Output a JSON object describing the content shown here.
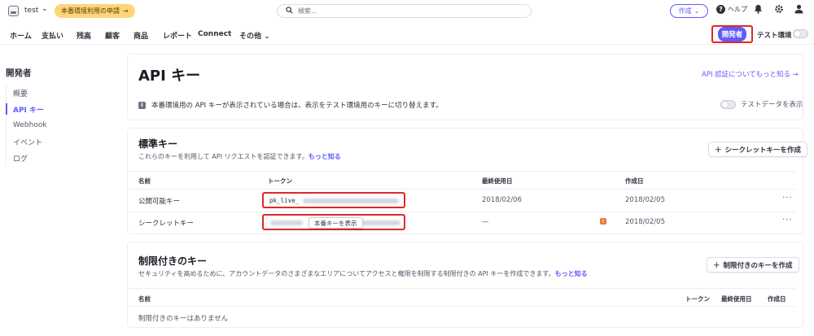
{
  "topbar": {
    "account_name": "test",
    "activate_label": "本番環境利用の申請",
    "search_placeholder": "検索...",
    "create_label": "作成",
    "help_label": "ヘルプ"
  },
  "nav": {
    "items": [
      "ホーム",
      "支払い",
      "残高",
      "顧客",
      "商品",
      "レポート",
      "Connect",
      "その他"
    ],
    "developer_label": "開発者",
    "test_mode_label": "テスト環境"
  },
  "sidebar": {
    "title": "開発者",
    "items": [
      {
        "label": "概要",
        "active": false
      },
      {
        "label": "API キー",
        "active": true
      },
      {
        "label": "Webhook",
        "active": false
      },
      {
        "label": "イベント",
        "active": false
      },
      {
        "label": "ログ",
        "active": false
      }
    ]
  },
  "page": {
    "title": "API キー",
    "learn_more": "API 認証についてもっと知る →",
    "notice": "本番環境用の API キーが表示されている場合は、表示をテスト環境用のキーに切り替えます。",
    "test_data_toggle": "テストデータを表示"
  },
  "standard": {
    "title": "標準キー",
    "desc": "これらのキーを利用して API リクエストを認証できます。",
    "desc_link": "もっと知る",
    "create_secret": "シークレットキーを作成",
    "headers": [
      "名前",
      "トークン",
      "最終使用日",
      "作成日"
    ],
    "rows": [
      {
        "name": "公開可能キー",
        "token": "pk_live_",
        "last_used": "2018/02/06",
        "created": "2018/02/05"
      },
      {
        "name": "シークレットキー",
        "reveal": "本番キーを表示",
        "last_used": "—",
        "created": "2018/02/05"
      }
    ]
  },
  "restricted": {
    "title": "制限付きのキー",
    "desc": "セキュリティを高めるために、アカウントデータのさまざまなエリアについてアクセスと権限を制限する制限付きの API キーを作成できます。",
    "desc_link": "もっと知る",
    "create_label": "制限付きのキーを作成",
    "headers": [
      "名前",
      "トークン",
      "最終使用日",
      "作成日"
    ],
    "empty": "制限付きのキーはありません"
  },
  "colors": {
    "accent": "#625afa",
    "highlight": "#e02828",
    "warning": "#e07b39",
    "activate_bg": "#fcd579"
  }
}
